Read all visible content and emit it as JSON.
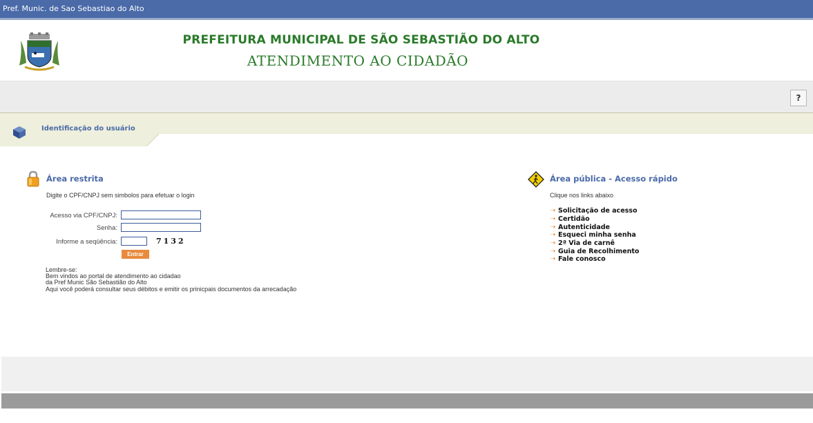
{
  "window": {
    "title": "Pref. Munic. de Sao Sebastiao do Alto"
  },
  "header": {
    "title": "PREFEITURA MUNICIPAL DE SÃO SEBASTIÃO DO ALTO",
    "subtitle": "ATENDIMENTO AO CIDADÃO"
  },
  "toolbar": {
    "help_label": "?"
  },
  "step": {
    "label": "Identificação do usuário"
  },
  "restricted": {
    "title": "Área restrita",
    "instruction": "Digite o CPF/CNPJ sem simbolos para efetuar o login",
    "cpf_label": "Acesso via CPF/CNPJ:",
    "cpf_value": "",
    "password_label": "Senha:",
    "password_value": "",
    "sequence_label": "Informe a seqüência:",
    "sequence_value": "",
    "captcha": "7132",
    "submit_label": "Entrar",
    "note_title": "Lembre-se:",
    "note_lines": [
      "Bem vindos ao portal de atendimento ao cidadao",
      "da Pref Munic São Sebastião do Alto",
      "Aqui você poderá consultar seus débitos e emitir os prinicpais documentos da arrecadação"
    ]
  },
  "public": {
    "title": "Área pública - Acesso rápido",
    "subtitle": "Clique nos links abaixo",
    "links": [
      "Solicitação de acesso",
      "Certidão",
      "Autenticidade",
      "Esqueci minha senha",
      "2ª Via de carnê",
      "Guia de Recolhimento",
      "Fale conosco"
    ]
  },
  "colors": {
    "topbar": "#4a6aa8",
    "title_green": "#2a7a2a",
    "section_blue": "#4a6aa8",
    "button_orange": "#e98a3d",
    "link_arrow": "#e08a2a"
  }
}
